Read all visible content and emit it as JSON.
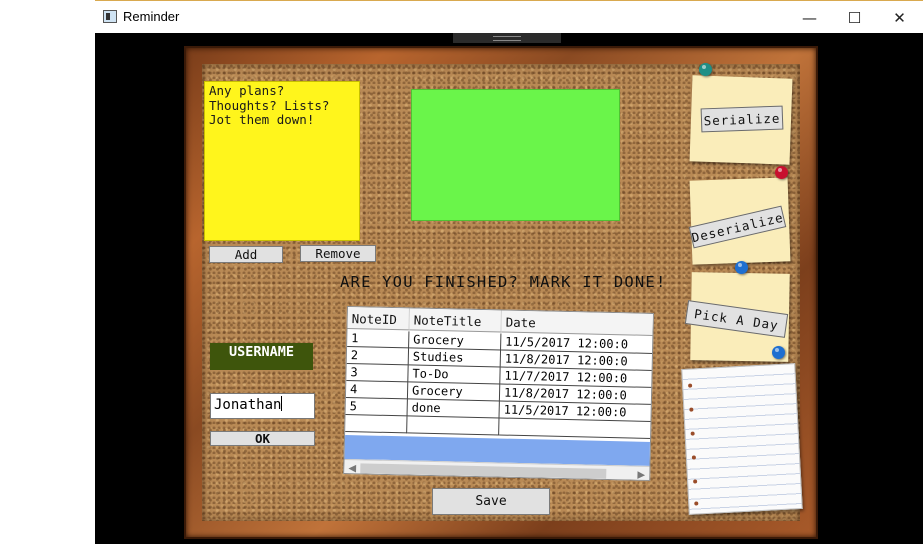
{
  "window": {
    "title": "Reminder",
    "controls": {
      "minimize": "—",
      "maximize": "☐",
      "close": "✕"
    }
  },
  "board": {
    "sticky_text": "Any plans?\nThoughts? Lists?\nJot them down!",
    "add_label": "Add",
    "remove_label": "Remove",
    "headline": "ARE YOU FINISHED? MARK IT DONE!",
    "username_label": "USERNAME",
    "username_value": "Jonathan",
    "ok_label": "OK",
    "save_label": "Save"
  },
  "side_buttons": {
    "serialize": "Serialize",
    "deserialize": "Deserialize",
    "pick_day": "Pick A Day"
  },
  "table": {
    "columns": [
      "NoteID",
      "NoteTitle",
      "Date"
    ],
    "rows": [
      [
        "1",
        "Grocery",
        "11/5/2017 12:00:0"
      ],
      [
        "2",
        "Studies",
        "11/8/2017 12:00:0"
      ],
      [
        "3",
        "To-Do",
        "11/7/2017 12:00:0"
      ],
      [
        "4",
        "Grocery",
        "11/8/2017 12:00:0"
      ],
      [
        "5",
        "done",
        "11/5/2017 12:00:0"
      ]
    ]
  },
  "colors": {
    "sticky": "#fff51c",
    "green_note": "#6af54a",
    "username_bg": "#3e550c",
    "selection": "#7fa8ef",
    "pin_teal": "#1f8f86",
    "pin_red": "#c8102e",
    "pin_blue": "#1e6fd0"
  },
  "icons": [
    "app-icon",
    "minimize-icon",
    "maximize-icon",
    "close-icon",
    "scroll-left-icon",
    "scroll-right-icon"
  ]
}
